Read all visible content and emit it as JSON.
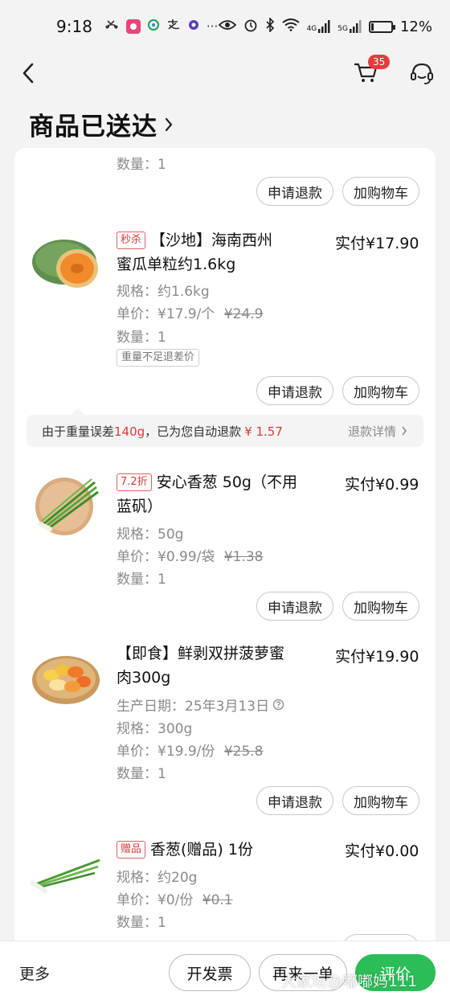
{
  "status_bar": {
    "time": "9:18",
    "left_icons": [
      "missed-call-icon",
      "app-icon",
      "china-mobile-icon",
      "alipay-icon",
      "more-dots-icon"
    ],
    "dots": "···",
    "network_4g": "4G",
    "network_5g": "5G",
    "battery": "12%"
  },
  "nav": {
    "cart_badge": "35"
  },
  "page": {
    "title": "商品已送达"
  },
  "items": [
    {
      "quantity": "数量：1",
      "refund_label": "申请退款",
      "cart_label": "加购物车"
    },
    {
      "tag": "秒杀",
      "title_line1": "【沙地】海南西州",
      "title_line2": "蜜瓜单粒约1.6kg",
      "paid": "实付¥17.90",
      "spec": "规格：约1.6kg",
      "unit_price_prefix": "单价：¥17.9/个",
      "original_price": "¥24.9",
      "quantity": "数量：1",
      "badge": "重量不足退差价",
      "refund_label": "申请退款",
      "cart_label": "加购物车",
      "refund_note": {
        "prefix": "由于重量误差",
        "weight": "140g",
        "middle": "，已为您自动退款",
        "amount": "¥ 1.57",
        "detail_link": "退款详情"
      }
    },
    {
      "tag": "7.2折",
      "title_line1": "安心香葱 50g（不用",
      "title_line2": "蓝矾）",
      "paid": "实付¥0.99",
      "spec": "规格：50g",
      "unit_price_prefix": "单价：¥0.99/袋",
      "original_price": "¥1.38",
      "quantity": "数量：1",
      "refund_label": "申请退款",
      "cart_label": "加购物车"
    },
    {
      "title_line1": "【即食】鲜剥双拼菠萝蜜",
      "title_line2": "肉300g",
      "paid": "实付¥19.90",
      "production_date": "生产日期：25年3月13日",
      "spec": "规格：300g",
      "unit_price_prefix": "单价：¥19.9/份",
      "original_price": "¥25.8",
      "quantity": "数量：1",
      "refund_label": "申请退款",
      "cart_label": "加购物车"
    },
    {
      "tag": "赠品",
      "title_line1": "香葱(赠品) 1份",
      "paid": "实付¥0.00",
      "spec": "规格：约20g",
      "unit_price_prefix": "单价：¥0/份",
      "original_price": "¥0.1",
      "quantity": "数量：1"
    }
  ],
  "bottom_bar": {
    "more": "更多",
    "invoice": "开发票",
    "reorder": "再来一单",
    "review": "评价"
  },
  "watermark": "大家坛@嘟嘟妈111",
  "colors": {
    "accent_green": "#2bbd57",
    "accent_red": "#d43b3b",
    "badge_red": "#e63b3b"
  }
}
